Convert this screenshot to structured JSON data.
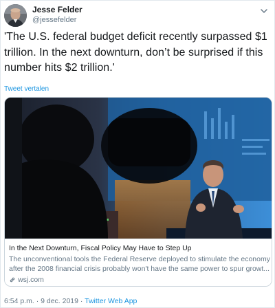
{
  "author": {
    "name": "Jesse Felder",
    "handle": "@jessefelder",
    "avatar_icon": "user-avatar"
  },
  "tweet": {
    "text": "'The U.S. federal budget deficit recently surpassed $1 trillion. In the next downturn, don’t be surprised if this number hits $2 trillion.'",
    "translate_label": "Tweet vertalen"
  },
  "card": {
    "image_icon": "news-photo",
    "title": "In the Next Downturn, Fiscal Policy May Have to Step Up",
    "description": "The unconventional tools the Federal Reserve deployed to stimulate the economy after the 2008 financial crisis probably won't have the same power to spur growt...",
    "domain": "wsj.com",
    "domain_icon": "link-icon"
  },
  "footer": {
    "time": "6:54 p.m. · 9 dec. 2019",
    "separator": " · ",
    "source": "Twitter Web App"
  },
  "colors": {
    "link": "#1b95e0",
    "secondary_text": "#657786",
    "primary_text": "#14171a",
    "border": "#ccd6dd"
  },
  "menu_icon": "chevron-down-icon"
}
